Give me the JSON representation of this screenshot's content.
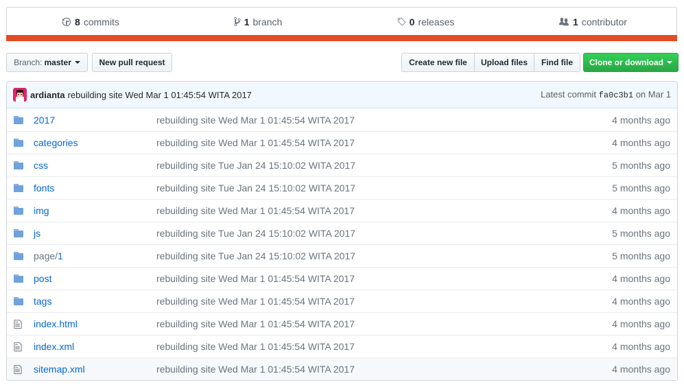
{
  "summary": {
    "commits": {
      "count": "8",
      "label": "commits",
      "icon": "history-icon"
    },
    "branches": {
      "count": "1",
      "label": "branch",
      "icon": "branch-icon"
    },
    "releases": {
      "count": "0",
      "label": "releases",
      "icon": "tag-icon"
    },
    "contributors": {
      "count": "1",
      "label": "contributor",
      "icon": "people-icon"
    },
    "language_color": "#e34c26"
  },
  "toolbar": {
    "branch_prefix": "Branch:",
    "branch_name": "master",
    "new_pull_request": "New pull request",
    "create_new_file": "Create new file",
    "upload_files": "Upload files",
    "find_file": "Find file",
    "clone_or_download": "Clone or download"
  },
  "latest_commit": {
    "author": "ardianta",
    "message": "rebuilding site Wed Mar 1 01:45:54 WITA 2017",
    "prefix": "Latest commit",
    "sha": "fa0c3b1",
    "date": "on Mar 1"
  },
  "files": [
    {
      "type": "folder",
      "name": "2017",
      "message": "rebuilding site Wed Mar 1 01:45:54 WITA 2017",
      "age": "4 months ago"
    },
    {
      "type": "folder",
      "name": "categories",
      "message": "rebuilding site Wed Mar 1 01:45:54 WITA 2017",
      "age": "4 months ago"
    },
    {
      "type": "folder",
      "name": "css",
      "message": "rebuilding site Tue Jan 24 15:10:02 WITA 2017",
      "age": "5 months ago"
    },
    {
      "type": "folder",
      "name": "fonts",
      "message": "rebuilding site Tue Jan 24 15:10:02 WITA 2017",
      "age": "5 months ago"
    },
    {
      "type": "folder",
      "name": "img",
      "message": "rebuilding site Wed Mar 1 01:45:54 WITA 2017",
      "age": "4 months ago"
    },
    {
      "type": "folder",
      "name": "js",
      "message": "rebuilding site Tue Jan 24 15:10:02 WITA 2017",
      "age": "5 months ago"
    },
    {
      "type": "folder",
      "name_prefix": "page/",
      "name": "1",
      "message": "rebuilding site Tue Jan 24 15:10:02 WITA 2017",
      "age": "5 months ago"
    },
    {
      "type": "folder",
      "name": "post",
      "message": "rebuilding site Wed Mar 1 01:45:54 WITA 2017",
      "age": "4 months ago"
    },
    {
      "type": "folder",
      "name": "tags",
      "message": "rebuilding site Wed Mar 1 01:45:54 WITA 2017",
      "age": "4 months ago"
    },
    {
      "type": "file",
      "name": "index.html",
      "message": "rebuilding site Wed Mar 1 01:45:54 WITA 2017",
      "age": "4 months ago"
    },
    {
      "type": "file",
      "name": "index.xml",
      "message": "rebuilding site Wed Mar 1 01:45:54 WITA 2017",
      "age": "4 months ago"
    },
    {
      "type": "file",
      "name": "sitemap.xml",
      "message": "rebuilding site Wed Mar 1 01:45:54 WITA 2017",
      "age": "4 months ago",
      "highlighted": true
    }
  ]
}
